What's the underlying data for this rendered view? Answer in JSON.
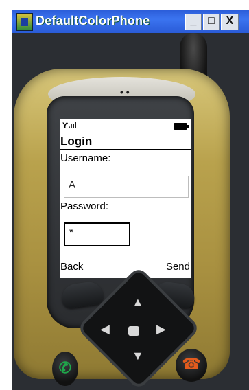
{
  "window": {
    "title": "DefaultColorPhone",
    "controls": {
      "minimize": "_",
      "maximize": "□",
      "close": "X"
    }
  },
  "phone": {
    "screen": {
      "status": {
        "signal_icon": "signal-strength",
        "signal_glyph": "Ƴ.ııl",
        "battery_icon": "battery"
      },
      "title": "Login",
      "username_label": "Username:",
      "username_value": "A",
      "password_label": "Password:",
      "password_value": "*",
      "soft_left": "Back",
      "soft_right": "Send"
    },
    "keys": {
      "call_glyph": "✆",
      "end_glyph": "☎"
    },
    "colors": {
      "body": "#b9a24d",
      "call": "#1fa64a",
      "end": "#e25b1d",
      "titlebar": "#2a5bd7"
    }
  }
}
